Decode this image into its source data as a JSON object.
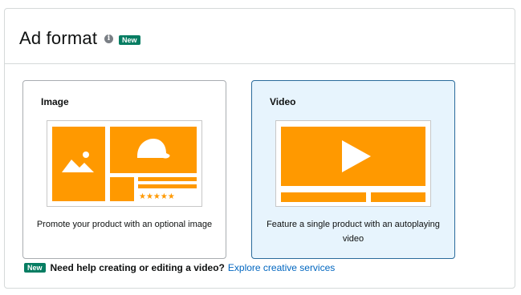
{
  "header": {
    "title": "Ad format",
    "info_icon": "info-icon",
    "badge": "New"
  },
  "cards": [
    {
      "title": "Image",
      "description": "Promote your product with an optional image",
      "selected": false
    },
    {
      "title": "Video",
      "description": "Feature a single product with an autoplaying video",
      "selected": true
    }
  ],
  "help": {
    "badge": "New",
    "text": "Need help creating or editing a video?",
    "link": "Explore creative services"
  },
  "colors": {
    "accent_orange": "#ff9900",
    "badge_green": "#067d62",
    "selected_bg": "#e7f4fd",
    "selected_border": "#2a6b9b",
    "link_blue": "#0066c0"
  }
}
